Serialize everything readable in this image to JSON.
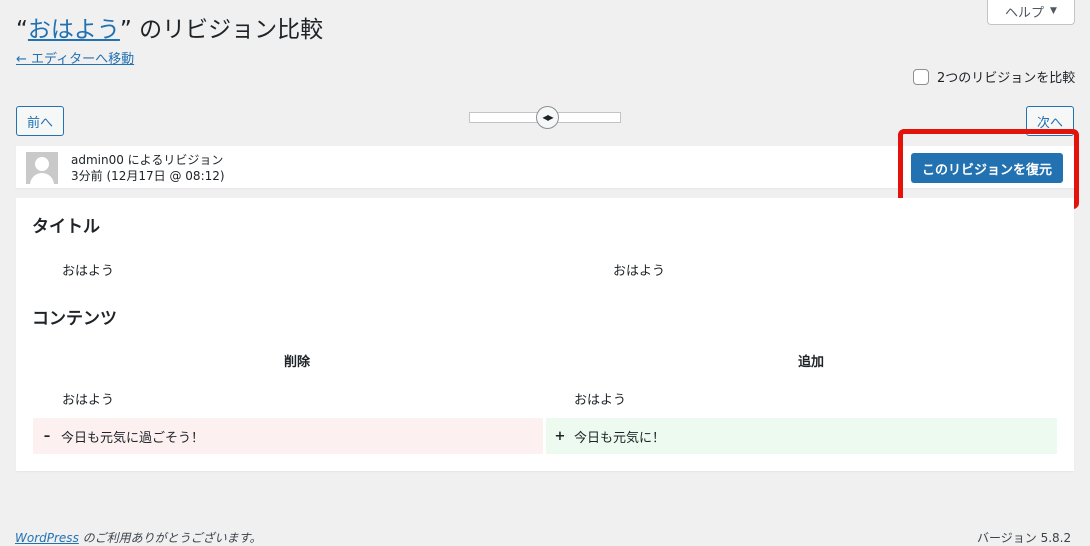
{
  "help": {
    "label": "ヘルプ",
    "caret": "▼"
  },
  "page": {
    "title_open_quote": "“",
    "title_post_name": "おはよう",
    "title_close_quote": "”",
    "title_suffix": " のリビジョン比較",
    "back_link": "← エディターへ移動"
  },
  "compare": {
    "label": "2つのリビジョンを比較",
    "checked": false
  },
  "nav": {
    "prev_label": "前へ",
    "next_label": "次へ",
    "slider_handle_glyph": "◀▶"
  },
  "revision_meta": {
    "author_line": "admin00 によるリビジョン",
    "time_line": "3分前 (12月17日 @ 08:12)",
    "restore_label": "このリビジョンを復元"
  },
  "diff": {
    "title_section": {
      "heading": "タイトル",
      "left_value": "おはよう",
      "right_value": "おはよう"
    },
    "content_section": {
      "heading": "コンテンツ",
      "removed_header": "削除",
      "added_header": "追加",
      "context_left": "おはよう",
      "context_right": "おはよう",
      "removed_sign": "–",
      "removed_line": "今日も元気に過ごそう！",
      "added_sign": "+",
      "added_line": "今日も元気に！"
    }
  },
  "footer": {
    "wp_link": "WordPress",
    "thanks_text": " のご利用ありがとうございます。",
    "version": "バージョン 5.8.2"
  },
  "colors": {
    "accent": "#2271b1",
    "highlight": "#e3120b",
    "removed_bg": "#fcf0f1",
    "added_bg": "#edfaef"
  }
}
